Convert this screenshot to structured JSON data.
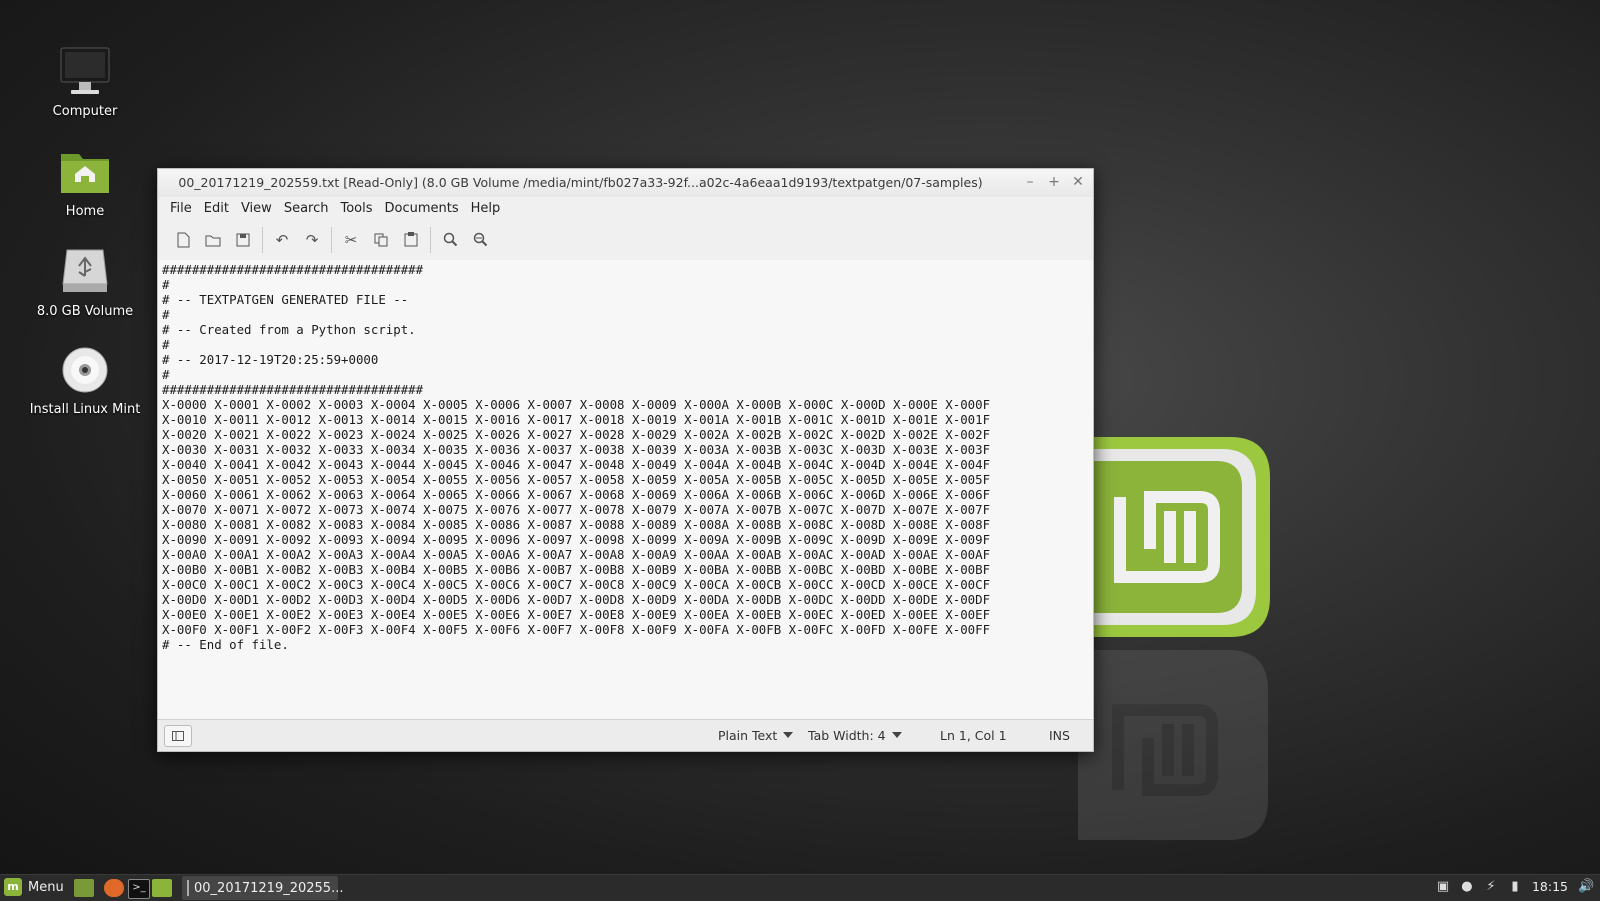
{
  "desktop": {
    "icons": [
      {
        "label": "Computer"
      },
      {
        "label": "Home"
      },
      {
        "label": "8.0 GB Volume"
      },
      {
        "label": "Install Linux Mint"
      }
    ]
  },
  "window": {
    "title": "00_20171219_202559.txt [Read-Only] (8.0 GB Volume /media/mint/fb027a33-92f...a02c-4a6eaa1d9193/textpatgen/07-samples)",
    "menu": [
      "File",
      "Edit",
      "View",
      "Search",
      "Tools",
      "Documents",
      "Help"
    ],
    "toolbar_icons": [
      "new-document-icon",
      "open-document-icon",
      "save-document-icon",
      "undo-icon",
      "redo-icon",
      "cut-icon",
      "copy-icon",
      "paste-icon",
      "search-icon",
      "search-replace-icon"
    ],
    "content": "###################################\n#\n# -- TEXTPATGEN GENERATED FILE --\n#\n# -- Created from a Python script.\n#\n# -- 2017-12-19T20:25:59+0000\n#\n###################################\nX-0000 X-0001 X-0002 X-0003 X-0004 X-0005 X-0006 X-0007 X-0008 X-0009 X-000A X-000B X-000C X-000D X-000E X-000F\nX-0010 X-0011 X-0012 X-0013 X-0014 X-0015 X-0016 X-0017 X-0018 X-0019 X-001A X-001B X-001C X-001D X-001E X-001F\nX-0020 X-0021 X-0022 X-0023 X-0024 X-0025 X-0026 X-0027 X-0028 X-0029 X-002A X-002B X-002C X-002D X-002E X-002F\nX-0030 X-0031 X-0032 X-0033 X-0034 X-0035 X-0036 X-0037 X-0038 X-0039 X-003A X-003B X-003C X-003D X-003E X-003F\nX-0040 X-0041 X-0042 X-0043 X-0044 X-0045 X-0046 X-0047 X-0048 X-0049 X-004A X-004B X-004C X-004D X-004E X-004F\nX-0050 X-0051 X-0052 X-0053 X-0054 X-0055 X-0056 X-0057 X-0058 X-0059 X-005A X-005B X-005C X-005D X-005E X-005F\nX-0060 X-0061 X-0062 X-0063 X-0064 X-0065 X-0066 X-0067 X-0068 X-0069 X-006A X-006B X-006C X-006D X-006E X-006F\nX-0070 X-0071 X-0072 X-0073 X-0074 X-0075 X-0076 X-0077 X-0078 X-0079 X-007A X-007B X-007C X-007D X-007E X-007F\nX-0080 X-0081 X-0082 X-0083 X-0084 X-0085 X-0086 X-0087 X-0088 X-0089 X-008A X-008B X-008C X-008D X-008E X-008F\nX-0090 X-0091 X-0092 X-0093 X-0094 X-0095 X-0096 X-0097 X-0098 X-0099 X-009A X-009B X-009C X-009D X-009E X-009F\nX-00A0 X-00A1 X-00A2 X-00A3 X-00A4 X-00A5 X-00A6 X-00A7 X-00A8 X-00A9 X-00AA X-00AB X-00AC X-00AD X-00AE X-00AF\nX-00B0 X-00B1 X-00B2 X-00B3 X-00B4 X-00B5 X-00B6 X-00B7 X-00B8 X-00B9 X-00BA X-00BB X-00BC X-00BD X-00BE X-00BF\nX-00C0 X-00C1 X-00C2 X-00C3 X-00C4 X-00C5 X-00C6 X-00C7 X-00C8 X-00C9 X-00CA X-00CB X-00CC X-00CD X-00CE X-00CF\nX-00D0 X-00D1 X-00D2 X-00D3 X-00D4 X-00D5 X-00D6 X-00D7 X-00D8 X-00D9 X-00DA X-00DB X-00DC X-00DD X-00DE X-00DF\nX-00E0 X-00E1 X-00E2 X-00E3 X-00E4 X-00E5 X-00E6 X-00E7 X-00E8 X-00E9 X-00EA X-00EB X-00EC X-00ED X-00EE X-00EF\nX-00F0 X-00F1 X-00F2 X-00F3 X-00F4 X-00F5 X-00F6 X-00F7 X-00F8 X-00F9 X-00FA X-00FB X-00FC X-00FD X-00FE X-00FF\n# -- End of file.",
    "status": {
      "language": "Plain Text",
      "tab_width": "Tab Width:  4",
      "position": "Ln 1, Col 1",
      "mode": "INS"
    }
  },
  "taskbar": {
    "menu_label": "Menu",
    "menu_logo_text": "m",
    "task_label": "00_20171219_20255...",
    "clock": "18:15"
  },
  "colors": {
    "mint_green": "#8cb33a",
    "desktop_dark": "#1e1e1e"
  }
}
